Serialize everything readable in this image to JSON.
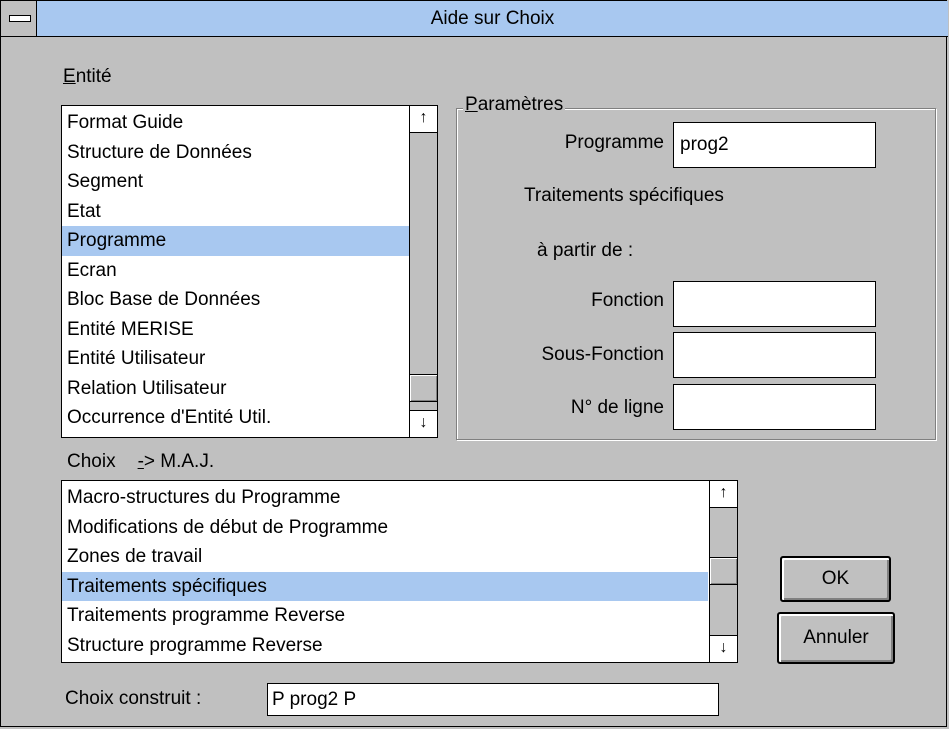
{
  "window": {
    "title": "Aide sur Choix"
  },
  "entite": {
    "label_u": "E",
    "label_rest": "ntité",
    "items": [
      "Format Guide",
      "Structure de Données",
      "Segment",
      "Etat",
      "Programme",
      "Ecran",
      "Bloc Base de Données",
      "Entité MERISE",
      "Entité Utilisateur",
      "Relation Utilisateur",
      "Occurrence d'Entité Util."
    ],
    "selected": "Programme"
  },
  "parametres": {
    "caption_u": "P",
    "caption_rest": "aramètres",
    "programme_label": "Programme",
    "programme_value": "prog2",
    "traitements_label": "Traitements spécifiques",
    "a_partir_label": "à partir de :",
    "fonction_label": "Fonction",
    "fonction_value": "",
    "sous_fonction_label": "Sous-Fonction",
    "sous_fonction_value": "",
    "ligne_label": "N° de ligne",
    "ligne_value": ""
  },
  "choix": {
    "label": "Choix",
    "maj_u": "-",
    "maj_rest": "> M.A.J.",
    "items": [
      "Macro-structures du Programme",
      "Modifications de début de Programme",
      "Zones de travail",
      "Traitements spécifiques",
      "Traitements programme Reverse",
      "Structure programme Reverse"
    ],
    "selected": "Traitements spécifiques"
  },
  "choix_construit": {
    "label": "Choix construit :",
    "value": "P prog2  P"
  },
  "buttons": {
    "ok": "OK",
    "annuler": "Annuler"
  },
  "icons": {
    "scroll_up": "▲",
    "scroll_down": "▼"
  }
}
